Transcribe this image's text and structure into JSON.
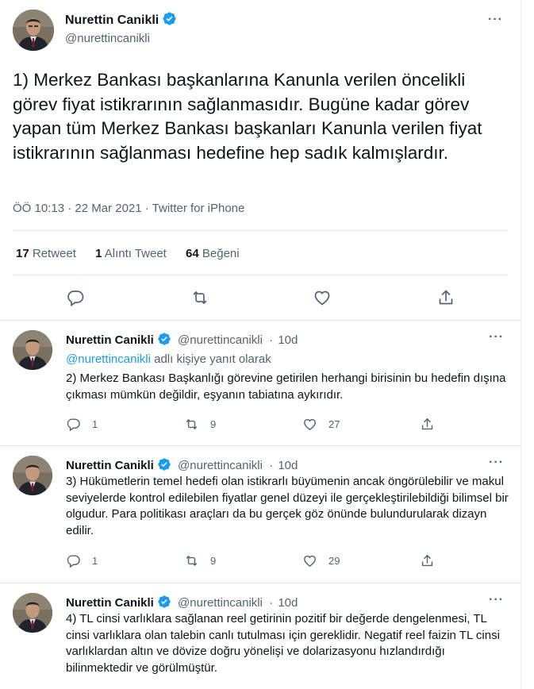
{
  "main_tweet": {
    "author_name": "Nurettin Canikli",
    "author_handle": "@nurettincanikli",
    "text": "1) Merkez Bankası başkanlarına Kanunla verilen öncelikli görev fiyat istikrarının sağlanmasıdır. Bugüne kadar görev yapan tüm Merkez Bankası başkanları Kanunla verilen fiyat istikrarının sağlanması hedefine hep sadık kalmışlardır.",
    "meta": "ÖÖ 10:13 · 22 Mar 2021 · Twitter for iPhone",
    "retweet_count": "17",
    "retweet_label": "Retweet",
    "quote_count": "1",
    "quote_label": "Alıntı Tweet",
    "like_count": "64",
    "like_label": "Beğeni",
    "more_icon": "more-icon",
    "verified_icon": "verified-badge-icon"
  },
  "replies": [
    {
      "author_name": "Nurettin Canikli",
      "author_handle": "@nurettincanikli",
      "time": "10d",
      "replying_mention": "@nurettincanikli",
      "replying_suffix": "adlı kişiye yanıt olarak",
      "text": "2) Merkez Bankası Başkanlığı görevine getirilen herhangi birisinin bu hedefin dışına çıkması mümkün değildir, eşyanın tabiatına aykırıdır.",
      "reply_count": "1",
      "retweet_count": "9",
      "like_count": "27"
    },
    {
      "author_name": "Nurettin Canikli",
      "author_handle": "@nurettincanikli",
      "time": "10d",
      "text": "3) Hükümetlerin temel hedefi olan istikrarlı büyümenin ancak öngörülebilir ve makul seviyelerde kontrol edilebilen fiyatlar genel düzeyi ile gerçekleştirilebildiği bilimsel bir olgudur. Para politikası araçları da bu gerçek göz önünde bulundurularak dizayn edilir.",
      "reply_count": "1",
      "retweet_count": "9",
      "like_count": "29"
    },
    {
      "author_name": "Nurettin Canikli",
      "author_handle": "@nurettincanikli",
      "time": "10d",
      "text": "4) TL cinsi varlıklara sağlanan reel getirinin pozitif bir değerde dengelenmesi, TL cinsi varlıklara olan talebin canlı tutulması için gereklidir. Negatif reel faizin TL cinsi varlıklardan altın ve dövize doğru yönelişi ve dolarizasyonu hızlandırdığı bilinmektedir ve görülmüştür."
    }
  ],
  "separator": "·",
  "colors": {
    "accent": "#1d9bf0",
    "text": "#0f1419",
    "secondary": "#536471",
    "border": "#e1e8ed"
  }
}
